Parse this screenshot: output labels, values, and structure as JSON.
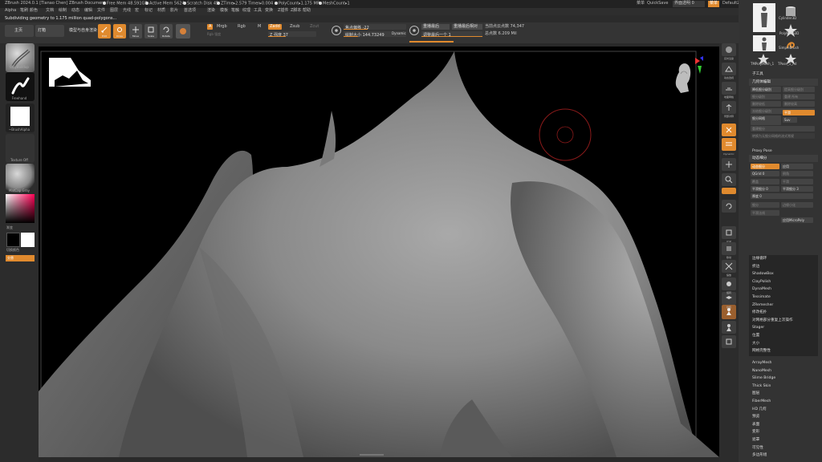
{
  "title_bar": {
    "app": "ZBrush 2024.0.1 [Tianao Chen]   ZBrush Document",
    "stats": [
      "Free Mem 48.591GB",
      "Active Mem 5624",
      "Scratch Disk 45",
      "ZTime▸2.579 Timer▸0.004",
      "PolyCount▸1.175 MP",
      "MeshCount▸1"
    ],
    "menus_label": "菜单",
    "quicksave": "QuickSave",
    "transparency": "界面透明 0",
    "default_script": "DefaultZScript"
  },
  "menu_bar": {
    "items": [
      "Alpha",
      "笔刷",
      "颜色",
      "文档",
      "绘制",
      "动态",
      "编辑",
      "文件",
      "图层",
      "光线",
      "宏",
      "标记",
      "材质",
      "影片",
      "首选项",
      "渲染",
      "模板",
      "笔触",
      "纹理",
      "工具",
      "变换",
      "Z插件",
      "Z脚本",
      "帮助"
    ]
  },
  "status": {
    "message": "Subdividing geometry to 1.175 million quad-polygons..."
  },
  "toolbar": {
    "projects_button": "主页",
    "lightbox_button": "灯箱",
    "model_label": "模型与自身渲染",
    "tool_buttons": [
      "Edit",
      "Draw",
      "Move",
      "Scale",
      "Rotate"
    ],
    "paint_flags": {
      "a": "A",
      "mrgb": "Mrgb",
      "rgb": "Rgb",
      "m": "M",
      "rgb_intensity": "Rgb 强度"
    },
    "zadd": "Zadd",
    "zsub": "Zsub",
    "zcut": "Zcut",
    "z_intensity": "Z 强度 37",
    "focal_shift": "焦点偏移 -22",
    "draw_size": "绘制大小 144.73249",
    "dynamic": "Dynamic",
    "replay_last": "重播最后",
    "replay_last_rel": "重播最后相对",
    "adjust_last": "调整最后一个 1",
    "active_points": "当前点云点数 74,347",
    "total_points": "总点数 6.209 Mil"
  },
  "left_shelf": {
    "brush_label": "ClayBuildup",
    "stroke_label": "Freehand",
    "alpha_label": "~BrushAlpha",
    "texture_label": "Texture Off",
    "material_label": "MatCap Gray",
    "color_label": "渐变",
    "switch_label": "切换颜色",
    "alternate_label": "交替"
  },
  "right_shelf": {
    "labels": [
      "实时渲染",
      "动态透视",
      "地面网格",
      "局部对称",
      "XYZ",
      "移动",
      "缩放",
      "旋转",
      "线框",
      "透明",
      "Dynamic",
      "实体"
    ]
  },
  "tray": {
    "tool_thumbs": [
      "Cylinder3D",
      "PolyMesh3D",
      "SimpleBrush",
      "TMPolyMesh_1",
      "TPose_1_Ad"
    ],
    "subtool_header": "子工具",
    "geometry_header": "几何体编辑",
    "geometry_rows": [
      {
        "label": "降低细分级别",
        "right": "提高细分级别"
      },
      {
        "label": "细分级别",
        "right": "重建 所有"
      },
      {
        "label": "删除较低",
        "right": "删除较高"
      },
      {
        "label": "冻结细分级别"
      }
    ],
    "divide_label": "细分网格",
    "smt_label": "平滑",
    "suv_label": "Suv",
    "reconstruct_label": "重建细分",
    "convert_label": "转换为无细分网格的流式常规",
    "proxy_pose": "Proxy Pose",
    "dynamic_subdiv_header": "动态细分",
    "dyn_rows": [
      {
        "label": "动态细分",
        "right": "应用"
      },
      {
        "label": "QGrid 0",
        "right": "倒角"
      },
      {
        "label": "覆盖",
        "right": "平滑"
      },
      {
        "label": "平滑细分 0",
        "right": "平滑细分 3"
      },
      {
        "label": "厚度 0",
        "right": ""
      },
      {
        "label": "细分",
        "right": "边缘小化"
      },
      {
        "label": "平滑法线",
        "right": "应用MicroPoly"
      }
    ],
    "list_items": [
      "边缘循环",
      "折边",
      "ShadowBox",
      "ClayPolish",
      "DynaMesh",
      "Tessimate",
      "ZRemesher",
      "修改拓扑",
      "对网格部分重复上次操作",
      "Stager",
      "位置",
      "大小",
      "网格完整性"
    ],
    "plugin_items": [
      "ArrayMesh",
      "NanoMesh",
      "Slime Bridge",
      "Thick Skin",
      "图层",
      "FiberMesh",
      "HD 几何",
      "预览",
      "表面",
      "变形",
      "遮罩",
      "可见性",
      "多边形组"
    ]
  }
}
